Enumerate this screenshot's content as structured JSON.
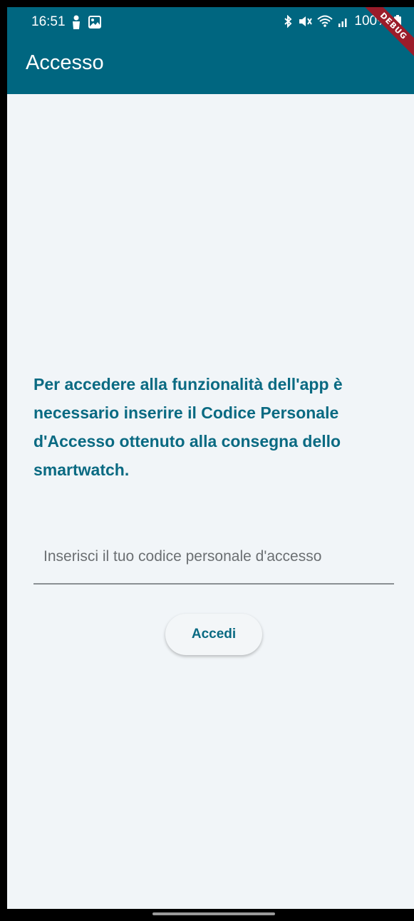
{
  "statusbar": {
    "time": "16:51",
    "battery_pct": "100%",
    "left_icons": [
      "person-icon",
      "gallery-icon"
    ],
    "right_icons": [
      "bluetooth-icon",
      "mute-icon",
      "wifi-icon",
      "signal-icon",
      "battery-icon"
    ]
  },
  "appbar": {
    "title": "Accesso",
    "color": "#006680"
  },
  "debug_banner": "DEBUG",
  "message": "Per accedere alla funzionalità dell'app è necessario inserire il Codice Personale d'Accesso ottenuto alla consegna dello smartwatch.",
  "code_field": {
    "placeholder": "Inserisci il tuo codice personale d'accesso",
    "value": ""
  },
  "submit_button": {
    "label": "Accedi"
  }
}
